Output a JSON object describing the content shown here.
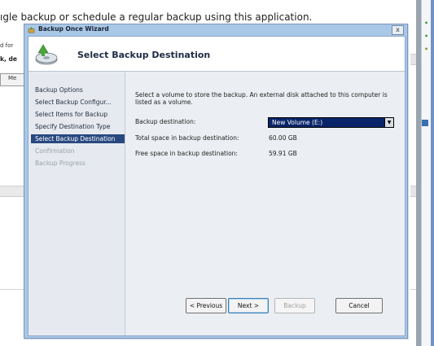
{
  "background": {
    "instructions_text": "ıgle backup or schedule a regular backup using this application.",
    "left_text_1": "d for",
    "left_text_2": "k, de",
    "left_box_label": "Me"
  },
  "wizard": {
    "title": "Backup Once Wizard",
    "close_label": "x",
    "page_heading": "Select Backup Destination",
    "steps": [
      {
        "label": "Backup Options",
        "state": "normal"
      },
      {
        "label": "Select Backup Configur...",
        "state": "normal"
      },
      {
        "label": "Select Items for Backup",
        "state": "normal"
      },
      {
        "label": "Specify Destination Type",
        "state": "normal"
      },
      {
        "label": "Select Backup Destination",
        "state": "active"
      },
      {
        "label": "Confirmation",
        "state": "disabled"
      },
      {
        "label": "Backup Progress",
        "state": "disabled"
      }
    ],
    "description": "Select a volume to store the backup. An external disk attached to this computer is listed as a volume.",
    "destination_label": "Backup destination:",
    "destination_value": "New Volume (E:)",
    "total_space_label": "Total space in backup destination:",
    "total_space_value": "60.00 GB",
    "free_space_label": "Free space in backup destination:",
    "free_space_value": "59.91 GB",
    "buttons": {
      "previous": "< Previous",
      "next": "Next >",
      "backup": "Backup",
      "cancel": "Cancel"
    }
  },
  "colors": {
    "title_bar": "#a9c7e6",
    "active_step": "#28497f",
    "select_highlight": "#0a246a"
  }
}
